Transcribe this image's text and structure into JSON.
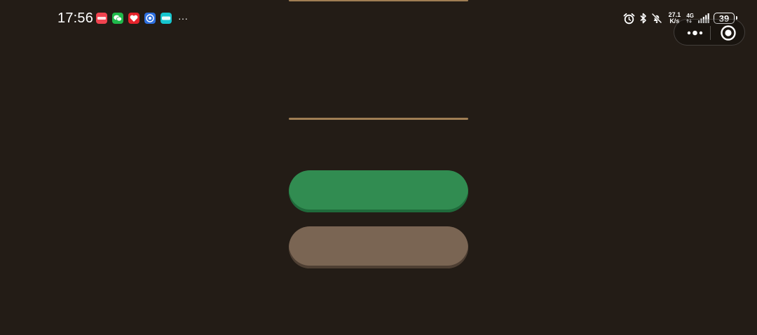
{
  "status_bar": {
    "time": "17:56",
    "notification_apps": [
      {
        "icon": "red-app-icon",
        "color": "#f0434f"
      },
      {
        "icon": "wechat-icon",
        "color": "#1fb94b"
      },
      {
        "icon": "heart-app-icon",
        "color": "#e5232b"
      },
      {
        "icon": "blue-app-icon",
        "color": "#2d6fe0"
      },
      {
        "icon": "taptap-icon",
        "color": "#15c5ce"
      }
    ],
    "more_notifications": "···",
    "net_speed_value": "27.1",
    "net_speed_unit": "K/s",
    "network_type": "4G",
    "battery_level": "39"
  },
  "capsule": {
    "more_icon": "more-dots-icon",
    "close_icon": "target-close-icon"
  },
  "form": {
    "field_color": "#a07e54",
    "first_field_value": "",
    "second_field_value": "",
    "primary_button_label": "",
    "secondary_button_label": "",
    "primary_color": "#318c51",
    "secondary_color": "#7a6553"
  }
}
